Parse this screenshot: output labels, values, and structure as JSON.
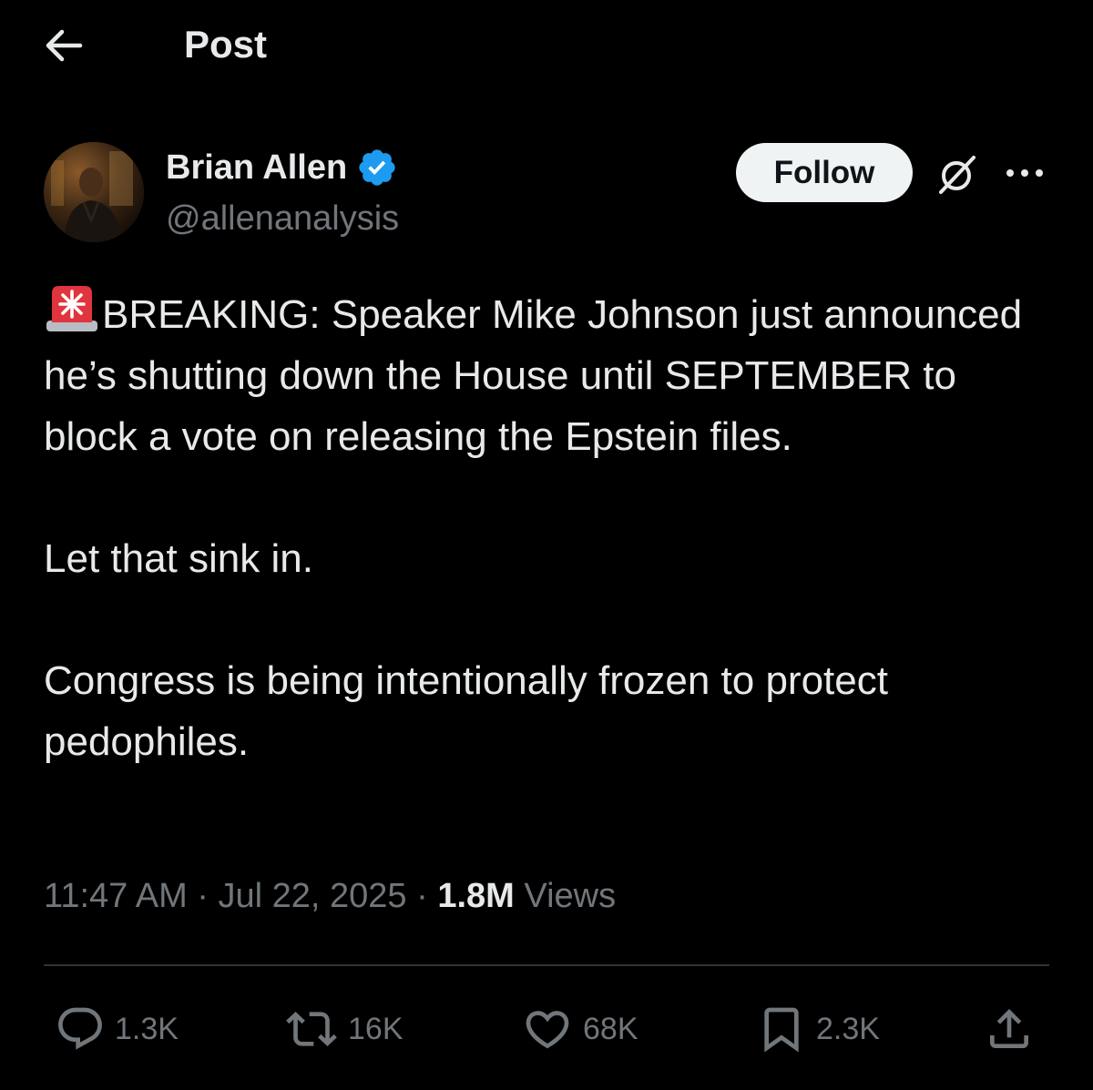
{
  "header": {
    "title": "Post"
  },
  "author": {
    "name": "Brian Allen",
    "handle": "@allenanalysis",
    "verified": true
  },
  "follow_label": "Follow",
  "post": {
    "paragraphs": [
      "BREAKING: Speaker Mike Johnson just announced he’s shutting down the House until SEPTEMBER to block a vote on releasing the Epstein files.",
      "Let that sink in.",
      "Congress is being intentionally frozen to protect pedophiles."
    ],
    "emoji": "siren"
  },
  "meta": {
    "time": "11:47 AM",
    "separator": "·",
    "date": "Jul 22, 2025",
    "views_count": "1.8M",
    "views_label": "Views"
  },
  "actions": {
    "replies": "1.3K",
    "reposts": "16K",
    "likes": "68K",
    "bookmarks": "2.3K"
  },
  "icons": {
    "back": "arrow-left-icon",
    "verified": "verified-badge-icon",
    "grok": "grok-icon",
    "more": "more-dots-icon",
    "reply": "reply-bubble-icon",
    "repost": "repost-icon",
    "like": "heart-icon",
    "bookmark": "bookmark-icon",
    "share": "share-icon"
  },
  "colors": {
    "background": "#000000",
    "text": "#e7e9ea",
    "secondary_text": "#71767b",
    "verified_blue": "#1d9bf0",
    "follow_bg": "#eff3f4",
    "siren_red": "#e0343e"
  }
}
